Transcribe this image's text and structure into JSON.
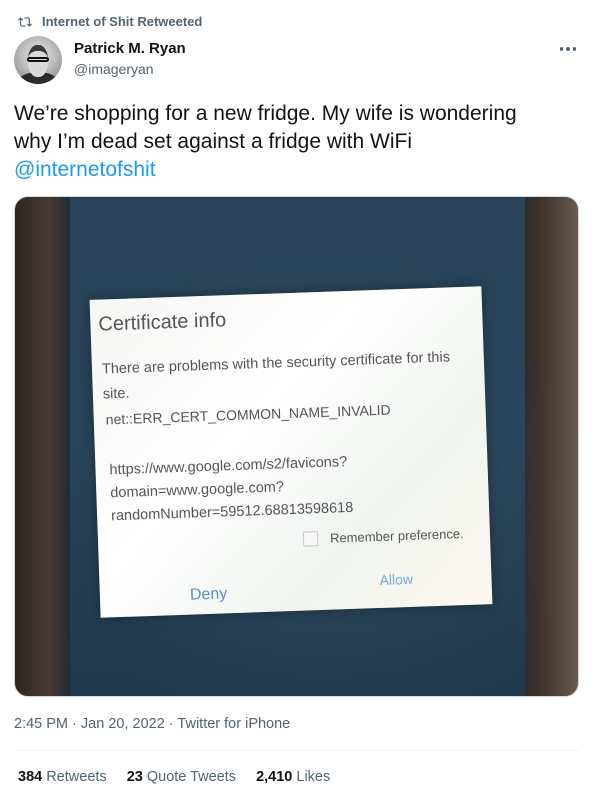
{
  "retweet_header": {
    "icon": "retweet-icon",
    "text": "Internet of Shit Retweeted"
  },
  "author": {
    "name": "Patrick M. Ryan",
    "handle": "@imageryan",
    "avatar_icon": "avatar"
  },
  "menu": {
    "icon": "more-options-icon"
  },
  "tweet": {
    "text_line1": "We’re shopping for a new fridge. My wife is wondering",
    "text_line2": "why I’m dead set against a fridge with WiFi",
    "mention": "@internetofshit"
  },
  "media_dialog": {
    "title": "Certificate info",
    "message": "There are problems with the security certificate for this site.",
    "error": "net::ERR_CERT_COMMON_NAME_INVALID",
    "url_line1": "https://www.google.com/s2/favicons?",
    "url_line2": "domain=www.google.com?",
    "url_line3": "randomNumber=59512.68813598618",
    "remember": "Remember preference.",
    "deny": "Deny",
    "allow": "Allow"
  },
  "meta": {
    "time": "2:45 PM",
    "date": "Jan 20, 2022",
    "source": "Twitter for iPhone",
    "sep": "·"
  },
  "stats": {
    "retweets_count": "384",
    "retweets_label": "Retweets",
    "quotes_count": "23",
    "quotes_label": "Quote Tweets",
    "likes_count": "2,410",
    "likes_label": "Likes"
  },
  "colors": {
    "link": "#1d9bf0",
    "secondary": "#536471",
    "primary_text": "#0f1419"
  }
}
